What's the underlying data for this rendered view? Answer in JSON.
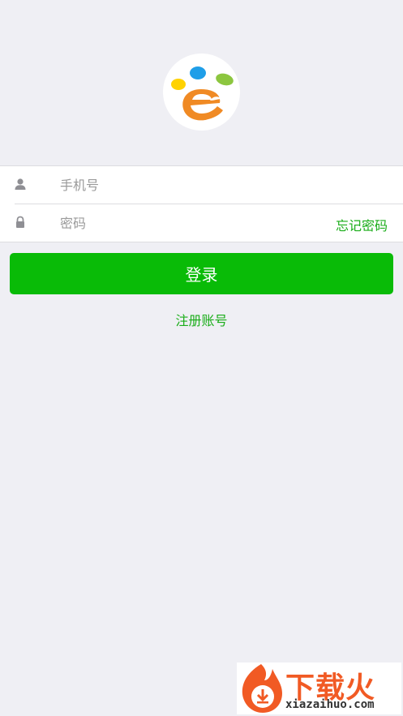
{
  "app": {
    "logo_icon": "brand-e-logo-icon",
    "accent_color": "#09bb07",
    "link_color": "#1aad19",
    "background_color": "#efeff4"
  },
  "form": {
    "phone": {
      "icon": "user-icon",
      "placeholder": "手机号",
      "value": ""
    },
    "password": {
      "icon": "lock-icon",
      "placeholder": "密码",
      "value": "",
      "forgot_label": "忘记密码"
    }
  },
  "actions": {
    "login_label": "登录",
    "register_label": "注册账号"
  },
  "watermark": {
    "title": "下载火",
    "url": "xiazaihuo.com",
    "icon": "download-flame-icon"
  }
}
